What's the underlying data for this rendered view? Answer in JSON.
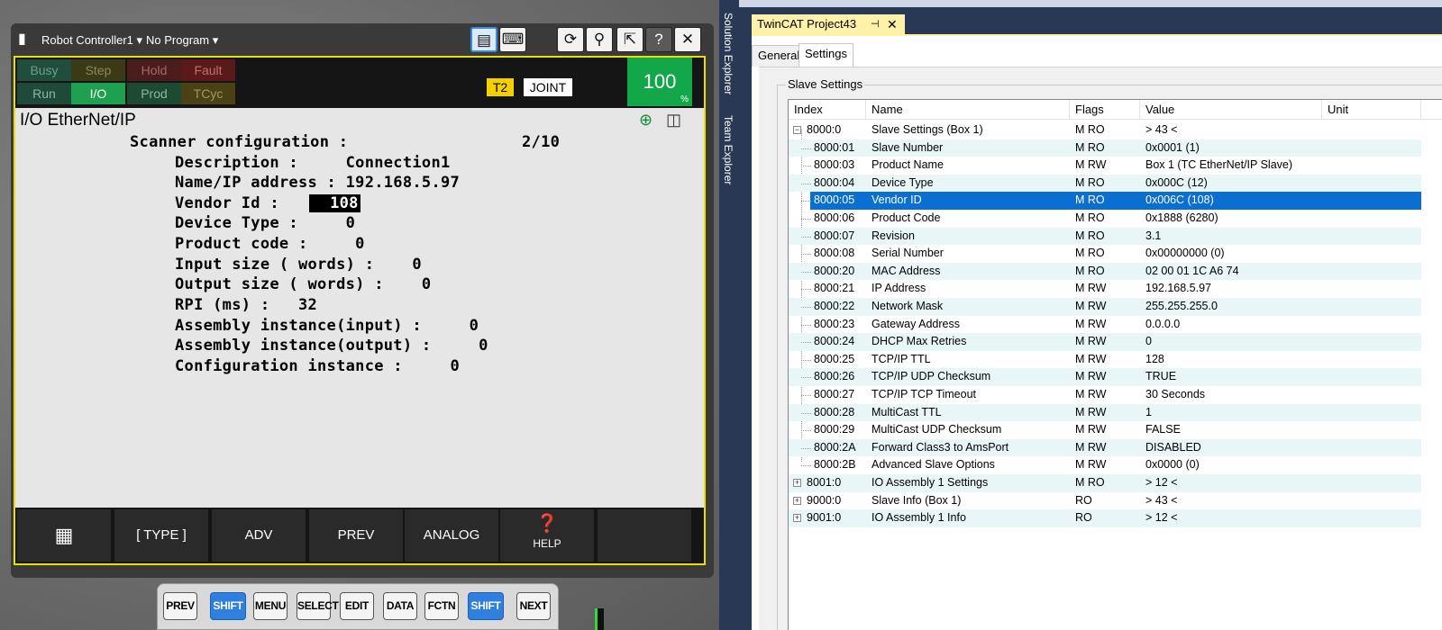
{
  "pendant": {
    "controller": "Robot Controller1",
    "program": "No Program",
    "status": {
      "busy": "Busy",
      "step": "Step",
      "hold": "Hold",
      "fault": "Fault",
      "run": "Run",
      "io": "I/O",
      "prod": "Prod",
      "tcyc": "TCyc"
    },
    "mode_t2": "T2",
    "coord": "JOINT",
    "override": "100",
    "override_unit": "%",
    "screen_title": "I/O EtherNet/IP",
    "lines": {
      "scanner_label": "Scanner configuration :",
      "scanner_page": "2/10",
      "description": "Description :     Connection1",
      "name_ip": "Name/IP address : 192.168.5.97",
      "vendor_label": "Vendor Id :",
      "vendor_value": "  108",
      "device_type": "Device Type :     0",
      "product_code": "Product code :     0",
      "input_size": "Input size ( words) :    0",
      "output_size": "Output size ( words) :    0",
      "rpi": "RPI (ms) :   32",
      "asm_input": "Assembly instance(input) :     0",
      "asm_output": "Assembly instance(output) :     0",
      "config_instance": "Configuration instance :     0"
    },
    "softkeys": {
      "type": "[ TYPE ]",
      "adv": "ADV",
      "prev": "PREV",
      "analog": "ANALOG",
      "help": "HELP"
    },
    "keys": {
      "prev": "PREV",
      "shift1": "SHIFT",
      "menu": "MENU",
      "select": "SELECT",
      "edit": "EDIT",
      "data": "DATA",
      "fctn": "FCTN",
      "shift2": "SHIFT",
      "next": "NEXT"
    }
  },
  "side_tabs": {
    "solution": "Solution Explorer",
    "team": "Team Explorer"
  },
  "twincat": {
    "doc_tab": "TwinCAT Project43",
    "tabs": {
      "general": "General",
      "settings": "Settings"
    },
    "group": "Slave Settings",
    "columns": {
      "index": "Index",
      "name": "Name",
      "flags": "Flags",
      "value": "Value",
      "unit": "Unit"
    },
    "rows": [
      {
        "index": "8000:0",
        "name": "Slave Settings (Box 1)",
        "flags": "M RO",
        "value": "> 43 <"
      },
      {
        "index": "8000:01",
        "name": "Slave Number",
        "flags": "M RO",
        "value": "0x0001 (1)"
      },
      {
        "index": "8000:03",
        "name": "Product Name",
        "flags": "M RW",
        "value": "Box 1 (TC EtherNet/IP Slave)"
      },
      {
        "index": "8000:04",
        "name": "Device Type",
        "flags": "M RO",
        "value": "0x000C (12)"
      },
      {
        "index": "8000:05",
        "name": "Vendor ID",
        "flags": "M RO",
        "value": "0x006C (108)"
      },
      {
        "index": "8000:06",
        "name": "Product Code",
        "flags": "M RO",
        "value": "0x1888 (6280)"
      },
      {
        "index": "8000:07",
        "name": "Revision",
        "flags": "M RO",
        "value": "3.1"
      },
      {
        "index": "8000:08",
        "name": "Serial Number",
        "flags": "M RO",
        "value": "0x00000000 (0)"
      },
      {
        "index": "8000:20",
        "name": "MAC Address",
        "flags": "M RO",
        "value": "02 00 01 1C A6 74"
      },
      {
        "index": "8000:21",
        "name": "IP Address",
        "flags": "M RW",
        "value": "192.168.5.97"
      },
      {
        "index": "8000:22",
        "name": "Network Mask",
        "flags": "M RW",
        "value": "255.255.255.0"
      },
      {
        "index": "8000:23",
        "name": "Gateway Address",
        "flags": "M RW",
        "value": "0.0.0.0"
      },
      {
        "index": "8000:24",
        "name": "DHCP Max Retries",
        "flags": "M RW",
        "value": "0"
      },
      {
        "index": "8000:25",
        "name": "TCP/IP TTL",
        "flags": "M RW",
        "value": "128"
      },
      {
        "index": "8000:26",
        "name": "TCP/IP UDP Checksum",
        "flags": "M RW",
        "value": "TRUE"
      },
      {
        "index": "8000:27",
        "name": "TCP/IP TCP Timeout",
        "flags": "M RW",
        "value": "30 Seconds"
      },
      {
        "index": "8000:28",
        "name": "MultiCast TTL",
        "flags": "M RW",
        "value": "1"
      },
      {
        "index": "8000:29",
        "name": "MultiCast UDP Checksum",
        "flags": "M RW",
        "value": "FALSE"
      },
      {
        "index": "8000:2A",
        "name": "Forward Class3 to AmsPort",
        "flags": "M RW",
        "value": "DISABLED"
      },
      {
        "index": "8000:2B",
        "name": "Advanced Slave Options",
        "flags": "M RW",
        "value": "0x0000 (0)"
      },
      {
        "index": "8001:0",
        "name": "IO Assembly 1 Settings",
        "flags": "M RO",
        "value": "> 12 <"
      },
      {
        "index": "9000:0",
        "name": "Slave Info (Box 1)",
        "flags": "RO",
        "value": "> 43 <"
      },
      {
        "index": "9001:0",
        "name": "IO Assembly 1 Info",
        "flags": "RO",
        "value": "> 12 <"
      }
    ],
    "tree": {
      "collapse": "−",
      "expand": "+"
    }
  }
}
